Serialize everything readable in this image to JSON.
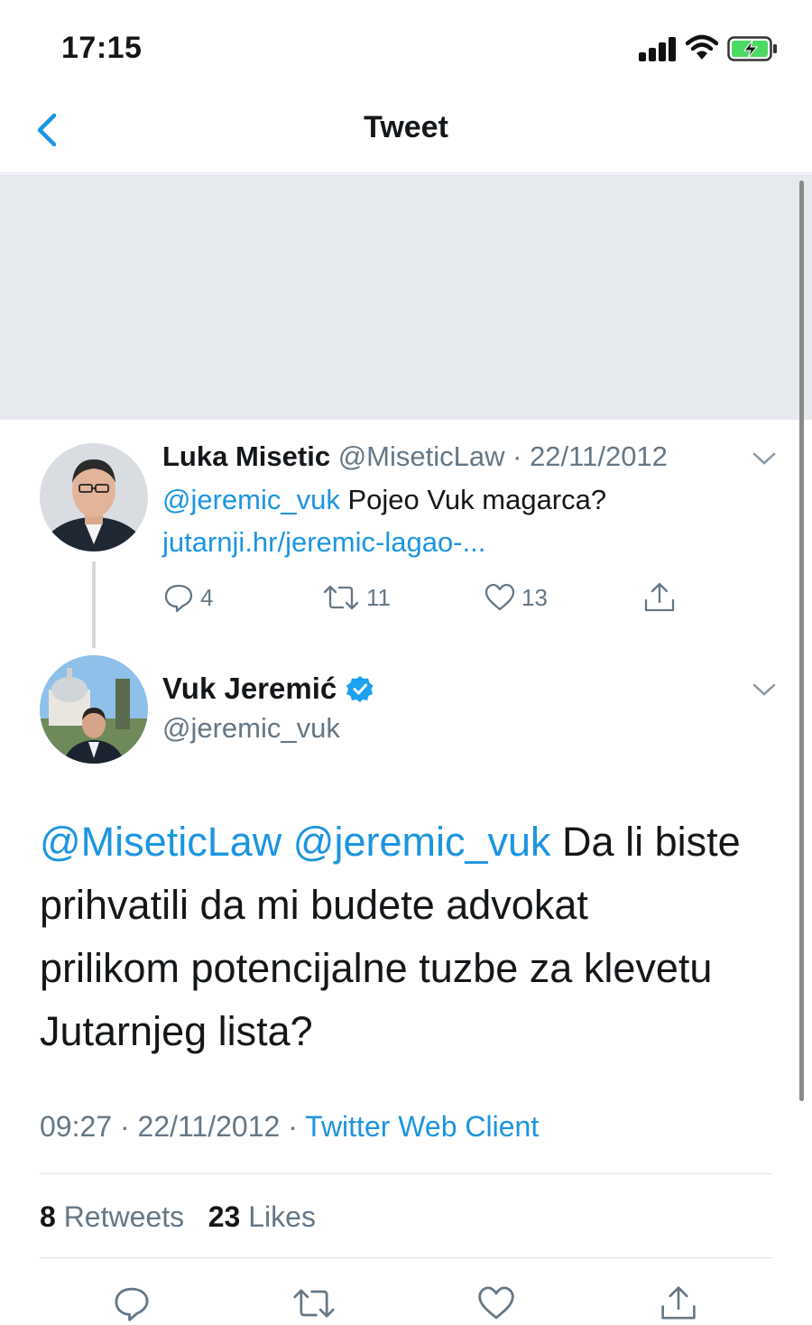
{
  "status_bar": {
    "time": "17:15"
  },
  "nav": {
    "title": "Tweet"
  },
  "parent_tweet": {
    "name": "Luka Misetic",
    "handle": "@MiseticLaw",
    "separator": "·",
    "date": "22/11/2012",
    "mention": "@jeremic_vuk",
    "text": "Pojeo Vuk magarca?",
    "link": "jutarnji.hr/jeremic-lagao-...",
    "replies": "4",
    "retweets": "11",
    "likes": "13"
  },
  "main_tweet": {
    "name": "Vuk Jeremić",
    "handle": "@jeremic_vuk",
    "mention1": "@MiseticLaw",
    "mention2": "@jeremic_vuk",
    "text_line1": "Da li biste",
    "text_line2": "prihvatili da mi budete advokat",
    "text_line3": "prilikom potencijalne tuzbe za klevetu",
    "text_line4": "Jutarnjeg lista?",
    "time": "09:27",
    "separator": "·",
    "date": "22/11/2012",
    "source": "Twitter Web Client",
    "retweet_count": "8",
    "retweet_label": "Retweets",
    "like_count": "23",
    "like_label": "Likes"
  },
  "colors": {
    "accent": "#1b95e0",
    "muted": "#657786",
    "verified": "#1da1f2",
    "battery": "#4cd964"
  }
}
